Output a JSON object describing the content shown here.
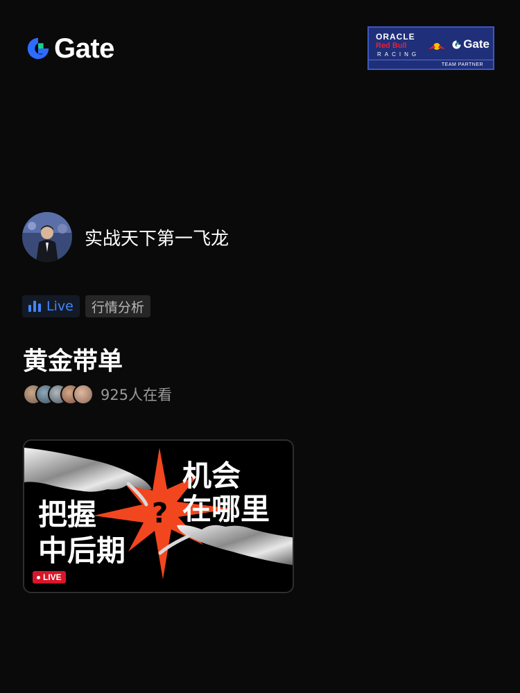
{
  "header": {
    "logo_text": "Gate",
    "partner": {
      "oracle": "ORACLE",
      "redbull": "Red Bull",
      "racing": "RACING",
      "gate_text": "Gate",
      "footer": "TEAM PARTNER"
    }
  },
  "host": {
    "name": "实战天下第一飞龙"
  },
  "tags": {
    "live_label": "Live",
    "category": "行情分析"
  },
  "stream": {
    "title": "黄金带单",
    "viewers_text": "925人在看"
  },
  "thumbnail": {
    "line1": "机会",
    "line2": "在哪里",
    "line3": "把握",
    "line4": "中后期",
    "question": "?",
    "live_badge": "LIVE"
  },
  "colors": {
    "background": "#0a0a0a",
    "accent_blue": "#3f86ff",
    "gate_green": "#16d28a",
    "live_red": "#d8162a",
    "burst_orange": "#f2461f"
  }
}
